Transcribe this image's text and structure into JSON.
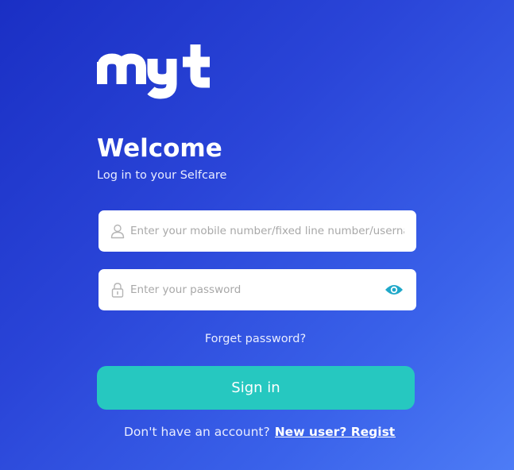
{
  "brand": {
    "logo_text": "myt",
    "logo_icon": "myt-logo",
    "accent_color": "#26c8c0",
    "background_colors": [
      "#1a2fc4",
      "#4d7cf6"
    ]
  },
  "header": {
    "title": "Welcome",
    "subtitle": "Log in to your Selfcare"
  },
  "form": {
    "username": {
      "icon": "user-icon",
      "placeholder": "Enter your mobile number/fixed line number/username/email",
      "value": ""
    },
    "password": {
      "icon": "lock-icon",
      "placeholder": "Enter your password",
      "value": "",
      "toggle_icon": "eye-icon"
    },
    "forgot_label": "Forget password?",
    "signin_label": "Sign in"
  },
  "footer": {
    "prompt": "Don't have an account?",
    "register_label": "New user? Register"
  }
}
